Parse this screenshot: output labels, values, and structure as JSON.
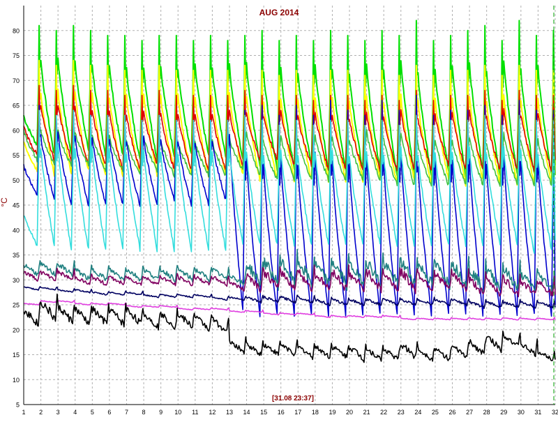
{
  "chart_data": {
    "type": "line",
    "title": "AUG 2014",
    "cursor_label": "[31.08 23:37]",
    "ylabel": "°C",
    "xlabel": "",
    "xlim": [
      1,
      32
    ],
    "ylim": [
      5,
      85
    ],
    "x_ticks": [
      "1",
      "2",
      "3",
      "4",
      "5",
      "6",
      "7",
      "8",
      "9",
      "10",
      "11",
      "12",
      "13",
      "14",
      "15",
      "16",
      "17",
      "18",
      "19",
      "20",
      "21",
      "22",
      "23",
      "24",
      "25",
      "26",
      "27",
      "28",
      "29",
      "30",
      "31",
      "32"
    ],
    "y_ticks": [
      "5",
      "10",
      "15",
      "20",
      "25",
      "30",
      "35",
      "40",
      "45",
      "50",
      "55",
      "60",
      "65",
      "70",
      "75",
      "80"
    ],
    "grid": true,
    "series": [
      {
        "color": "#00e000",
        "kind": "daily_peak",
        "peaks": [
          81,
          80,
          81,
          80,
          79,
          79,
          78,
          79,
          79,
          78,
          79,
          78,
          79,
          80,
          78,
          79,
          78,
          80,
          79,
          78,
          80,
          79,
          82,
          78,
          79,
          80,
          81,
          78,
          82,
          79,
          80
        ],
        "mins": [
          57,
          55,
          55,
          56,
          55,
          55,
          54,
          54,
          55,
          55,
          55,
          55,
          54,
          53,
          52,
          52,
          53,
          52,
          52,
          52,
          52,
          51,
          51,
          51,
          52,
          51,
          52,
          51,
          51,
          51,
          51
        ]
      },
      {
        "color": "#ffff00",
        "kind": "daily_peak",
        "peaks": [
          74,
          73,
          74,
          73,
          73,
          72,
          72,
          73,
          72,
          72,
          72,
          72,
          73,
          72,
          71,
          72,
          71,
          72,
          72,
          71,
          72,
          71,
          73,
          71,
          72,
          72,
          73,
          71,
          73,
          72,
          72
        ],
        "mins": [
          52,
          51,
          51,
          52,
          51,
          51,
          51,
          51,
          52,
          51,
          51,
          51,
          51,
          50,
          50,
          50,
          50,
          50,
          50,
          50,
          50,
          49,
          50,
          49,
          50,
          49,
          50,
          49,
          49,
          49,
          49
        ]
      },
      {
        "color": "#e00000",
        "kind": "daily_peak",
        "peaks": [
          69,
          68,
          69,
          68,
          68,
          67,
          67,
          68,
          67,
          67,
          67,
          67,
          68,
          67,
          66,
          67,
          66,
          67,
          67,
          66,
          67,
          66,
          68,
          66,
          67,
          67,
          68,
          66,
          68,
          67,
          67
        ],
        "mins": [
          55,
          54,
          54,
          53,
          53,
          52,
          52,
          53,
          52,
          52,
          52,
          52,
          53,
          54,
          54,
          53,
          53,
          52,
          52,
          52,
          52,
          52,
          52,
          52,
          53,
          52,
          52,
          52,
          52,
          52,
          52
        ]
      },
      {
        "color": "#40c040",
        "kind": "daily_peak",
        "peaks": [
          63,
          62,
          62,
          62,
          61,
          61,
          60,
          61,
          60,
          60,
          60,
          60,
          61,
          62,
          60,
          62,
          61,
          62,
          61,
          61,
          63,
          61,
          63,
          60,
          61,
          61,
          62,
          60,
          63,
          61,
          61
        ],
        "mins": [
          54,
          53,
          53,
          53,
          52,
          52,
          51,
          52,
          51,
          51,
          51,
          51,
          52,
          51,
          50,
          50,
          50,
          50,
          50,
          50,
          50,
          49,
          49,
          49,
          49,
          49,
          49,
          49,
          49,
          49,
          49
        ]
      },
      {
        "color": "#0000cc",
        "kind": "daily_peak",
        "peaks": [
          65,
          63,
          64,
          63,
          63,
          63,
          62,
          63,
          62,
          62,
          62,
          62,
          64,
          65,
          63,
          65,
          63,
          66,
          64,
          63,
          66,
          64,
          67,
          63,
          64,
          64,
          65,
          63,
          66,
          64,
          64
        ],
        "mins": [
          47,
          46,
          45,
          45,
          45,
          45,
          45,
          45,
          46,
          45,
          45,
          46,
          24,
          23,
          23,
          23,
          23,
          23,
          23,
          23,
          23,
          23,
          23,
          23,
          23,
          23,
          23,
          23,
          23,
          23,
          23
        ]
      },
      {
        "color": "#33dddd",
        "kind": "daily_peak",
        "peaks": [
          64,
          63,
          64,
          63,
          63,
          63,
          62,
          63,
          62,
          62,
          62,
          62,
          63,
          62,
          61,
          62,
          61,
          62,
          62,
          61,
          62,
          61,
          63,
          61,
          62,
          62,
          63,
          61,
          63,
          62,
          62
        ],
        "mins": [
          37,
          37,
          36,
          36,
          36,
          36,
          36,
          36,
          36,
          36,
          36,
          36,
          37,
          37,
          37,
          37,
          37,
          37,
          37,
          37,
          37,
          37,
          37,
          37,
          37,
          37,
          37,
          37,
          37,
          35,
          36
        ]
      },
      {
        "color": "#208080",
        "kind": "daily_wave",
        "base": [
          31,
          31,
          31,
          30,
          30,
          30,
          30,
          30,
          30,
          30,
          30,
          30,
          29,
          29,
          29,
          29,
          29,
          29,
          29,
          29,
          29,
          29,
          29,
          29,
          29,
          29,
          28,
          28,
          28,
          28,
          28
        ],
        "amp": [
          4,
          4,
          4,
          4,
          4,
          4,
          4,
          4,
          4,
          4,
          4,
          4,
          4,
          8,
          9,
          9,
          9,
          8,
          9,
          8,
          9,
          8,
          9,
          8,
          8,
          8,
          8,
          8,
          8,
          6,
          6
        ]
      },
      {
        "color": "#800060",
        "kind": "daily_wave",
        "base": [
          30,
          30,
          30,
          29,
          29,
          29,
          29,
          29,
          29,
          29,
          29,
          29,
          28,
          28,
          28,
          28,
          28,
          28,
          28,
          28,
          28,
          28,
          28,
          28,
          28,
          28,
          27,
          27,
          27,
          27,
          27
        ],
        "amp": [
          3,
          3,
          3,
          3,
          3,
          3,
          3,
          3,
          3,
          3,
          3,
          3,
          3,
          6,
          7,
          7,
          7,
          6,
          7,
          6,
          7,
          6,
          7,
          6,
          6,
          6,
          6,
          6,
          6,
          5,
          5
        ]
      },
      {
        "color": "#000060",
        "kind": "daily_wave",
        "base": [
          28,
          28,
          27.5,
          27.5,
          27,
          27,
          27,
          26.5,
          26.5,
          26.5,
          26.5,
          26,
          26,
          25.5,
          25.5,
          25.5,
          25.5,
          25,
          25,
          25,
          25,
          25,
          25,
          25,
          25,
          25,
          24.5,
          24.5,
          24.5,
          24.5,
          24.5
        ],
        "amp": [
          1,
          1,
          1,
          1,
          1,
          1,
          1,
          1,
          1,
          1,
          1,
          1,
          1,
          2,
          2,
          2,
          2,
          2,
          2,
          2,
          2,
          2,
          2,
          2,
          2,
          2,
          2,
          2,
          2,
          2,
          2
        ]
      },
      {
        "color": "#e040e0",
        "kind": "daily_wave",
        "base": [
          25,
          25.5,
          25.5,
          25,
          25,
          25,
          24.5,
          24.5,
          24.5,
          24,
          24,
          24,
          23.5,
          23.5,
          23,
          23,
          23,
          22.5,
          22.5,
          22.5,
          22.5,
          22.5,
          22,
          22,
          22,
          22,
          22,
          22,
          22,
          22,
          22
        ],
        "amp": [
          0.6,
          0.6,
          0.6,
          0.6,
          0.6,
          0.6,
          0.6,
          0.6,
          0.6,
          0.6,
          0.6,
          0.6,
          0.6,
          0.6,
          0.6,
          0.6,
          0.6,
          0.6,
          0.6,
          0.6,
          0.6,
          0.6,
          0.6,
          0.6,
          0.6,
          0.6,
          0.6,
          0.6,
          0.6,
          0.6,
          0.6
        ]
      },
      {
        "color": "#000000",
        "kind": "daily_wave",
        "base": [
          21,
          22,
          21.5,
          21,
          21,
          21,
          21,
          20.5,
          20.5,
          20.5,
          20,
          19.5,
          15.5,
          15,
          15,
          15,
          14.5,
          14.5,
          14.5,
          14,
          14,
          14,
          14.5,
          14,
          14,
          14.5,
          15,
          16,
          16.5,
          15,
          14
        ],
        "amp": [
          6,
          7,
          6,
          6,
          6,
          6,
          6,
          5,
          5,
          5,
          5,
          5,
          4,
          4,
          4,
          4,
          4,
          4,
          4,
          5,
          4,
          4,
          5,
          4,
          4,
          4,
          5,
          5,
          5,
          4,
          3
        ]
      }
    ]
  }
}
